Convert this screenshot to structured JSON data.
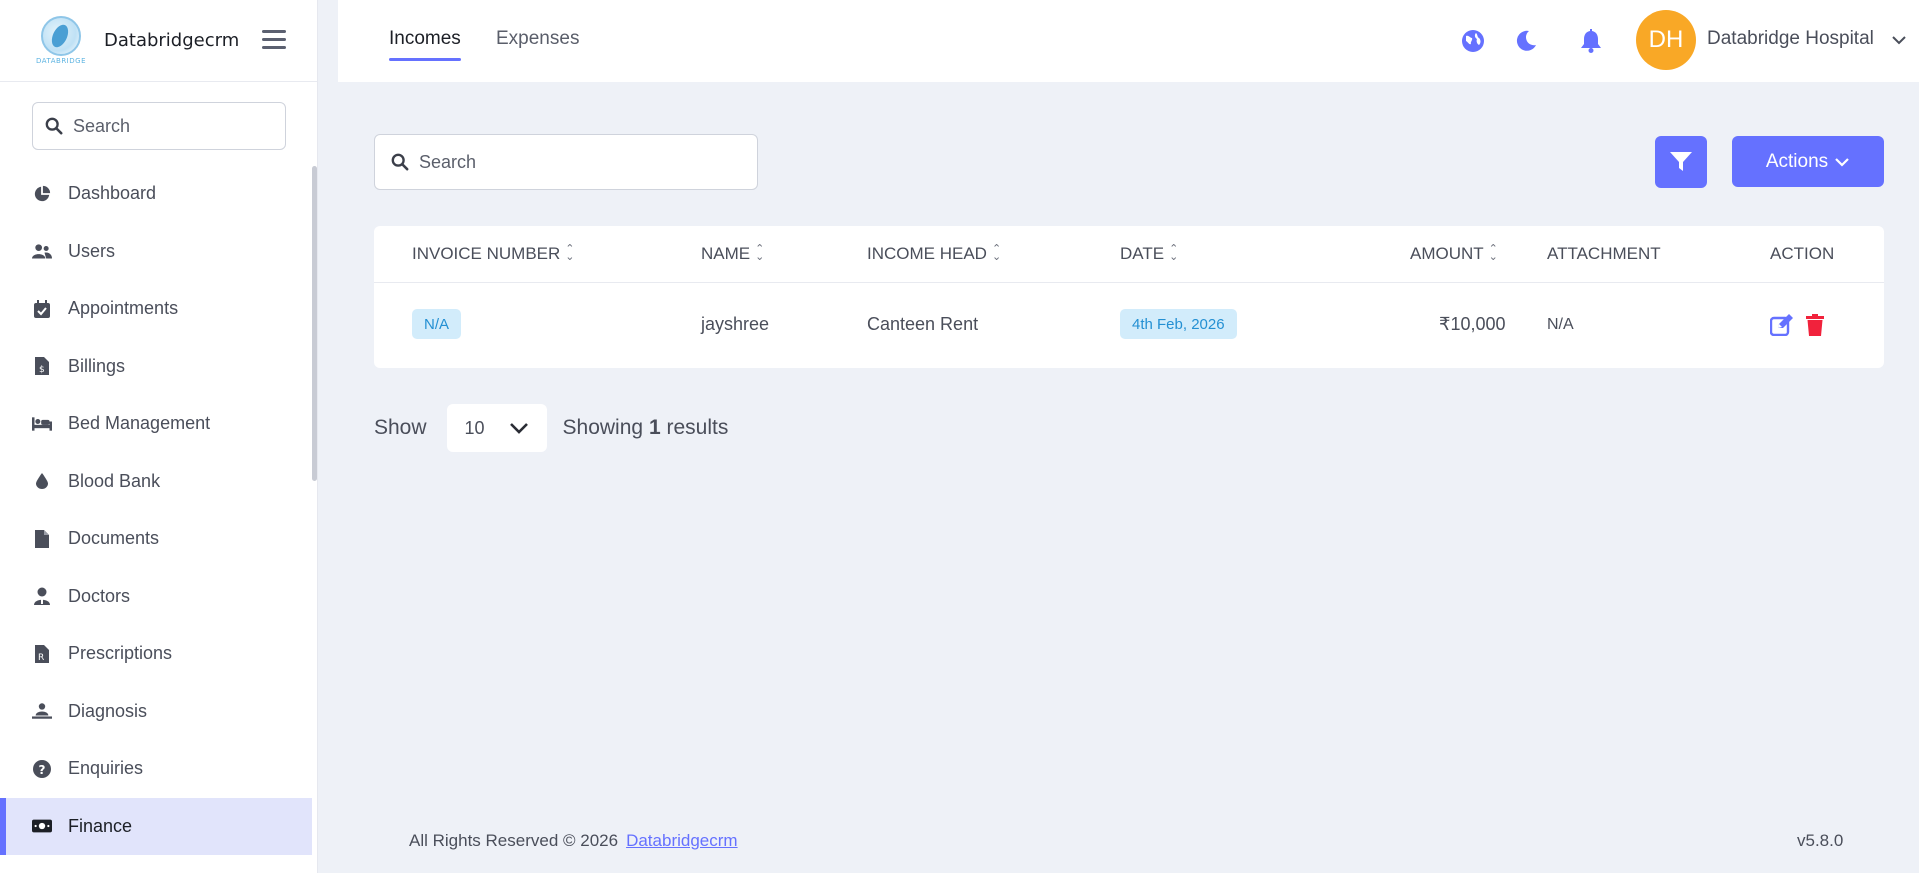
{
  "brand": {
    "name": "Databridgecrm",
    "logo_text": "DATABRIDGE"
  },
  "sidebar": {
    "search_placeholder": "Search",
    "items": [
      {
        "label": "Dashboard",
        "icon": "pie-chart-icon"
      },
      {
        "label": "Users",
        "icon": "users-icon"
      },
      {
        "label": "Appointments",
        "icon": "calendar-check-icon"
      },
      {
        "label": "Billings",
        "icon": "file-invoice-icon"
      },
      {
        "label": "Bed Management",
        "icon": "bed-icon"
      },
      {
        "label": "Blood Bank",
        "icon": "droplet-icon"
      },
      {
        "label": "Documents",
        "icon": "file-icon"
      },
      {
        "label": "Doctors",
        "icon": "doctor-icon"
      },
      {
        "label": "Prescriptions",
        "icon": "prescription-icon"
      },
      {
        "label": "Diagnosis",
        "icon": "diagnosis-icon"
      },
      {
        "label": "Enquiries",
        "icon": "question-circle-icon"
      },
      {
        "label": "Finance",
        "icon": "money-bill-icon",
        "active": true
      }
    ]
  },
  "topbar": {
    "tabs": [
      {
        "label": "Incomes",
        "active": true
      },
      {
        "label": "Expenses",
        "active": false
      }
    ],
    "avatar_initials": "DH",
    "user_name": "Databridge Hospital"
  },
  "main": {
    "search_placeholder": "Search",
    "actions_label": "Actions",
    "table": {
      "headers": [
        "INVOICE NUMBER",
        "NAME",
        "INCOME HEAD",
        "DATE",
        "AMOUNT",
        "ATTACHMENT",
        "ACTION"
      ],
      "rows": [
        {
          "invoice_number": "N/A",
          "name": "jayshree",
          "income_head": "Canteen Rent",
          "date": "4th Feb, 2026",
          "amount": "₹10,000",
          "attachment": "N/A"
        }
      ]
    },
    "pagination": {
      "show_label": "Show",
      "per_page": "10",
      "showing_prefix": "Showing",
      "count": "1",
      "showing_suffix": "results"
    }
  },
  "footer": {
    "copyright": "All Rights Reserved © 2026",
    "link": "Databridgecrm",
    "version": "v5.8.0"
  },
  "colors": {
    "accent": "#6571ff",
    "avatar": "#f9a826",
    "delete": "#f1223c",
    "badge_bg": "#d2ecfb",
    "badge_text": "#2490d3",
    "background": "#eef1f7"
  }
}
